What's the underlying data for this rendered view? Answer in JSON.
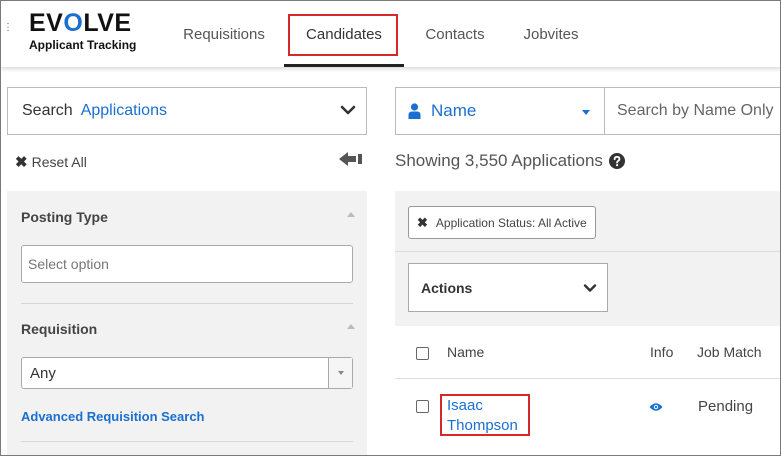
{
  "brand": {
    "logo_pre": "EV",
    "logo_accent": "O",
    "logo_post": "LVE",
    "subtitle": "Applicant Tracking"
  },
  "nav": {
    "tabs": [
      {
        "label": "Requisitions",
        "active": false
      },
      {
        "label": "Candidates",
        "active": true
      },
      {
        "label": "Contacts",
        "active": false
      },
      {
        "label": "Jobvites",
        "active": false
      }
    ]
  },
  "sidebar": {
    "search_label": "Search",
    "search_value": "Applications",
    "reset_label": "Reset All",
    "filters": {
      "posting_type": {
        "title": "Posting Type",
        "placeholder": "Select option"
      },
      "requisition": {
        "title": "Requisition",
        "value": "Any",
        "link": "Advanced Requisition Search"
      }
    }
  },
  "main": {
    "search_field": "Name",
    "search_placeholder": "Search by Name Only",
    "showing_text": "Showing 3,550 Applications",
    "filter_chip": "Application Status: All Active",
    "actions_label": "Actions",
    "table": {
      "headers": {
        "name": "Name",
        "info": "Info",
        "job_match": "Job Match"
      },
      "rows": [
        {
          "name_line1": "Isaac",
          "name_line2": "Thompson",
          "job_match": "Pending"
        }
      ]
    }
  },
  "colors": {
    "accent": "#1a6fd1",
    "highlight": "#d62828",
    "panel_bg": "#f2f2f2"
  },
  "icons": [
    "chevron-down-icon",
    "close-icon",
    "arrow-left-icon",
    "person-icon",
    "help-icon",
    "eye-icon"
  ]
}
